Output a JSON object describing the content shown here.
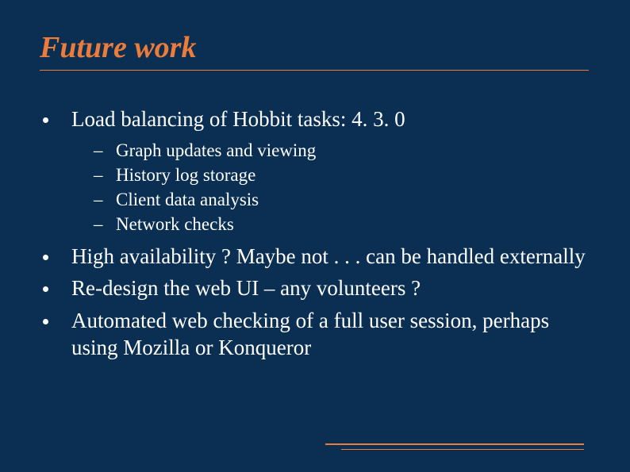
{
  "title": "Future work",
  "bullets": {
    "b0": "Load balancing of Hobbit tasks: 4. 3. 0",
    "b0_sub": {
      "s0": "Graph updates and viewing",
      "s1": "History log storage",
      "s2": "Client data analysis",
      "s3": "Network checks"
    },
    "b1": "High availability ? Maybe not . . . can be handled externally",
    "b2": "Re-design the web UI – any volunteers ?",
    "b3": "Automated web checking of a full user session, perhaps using Mozilla or Konqueror"
  }
}
